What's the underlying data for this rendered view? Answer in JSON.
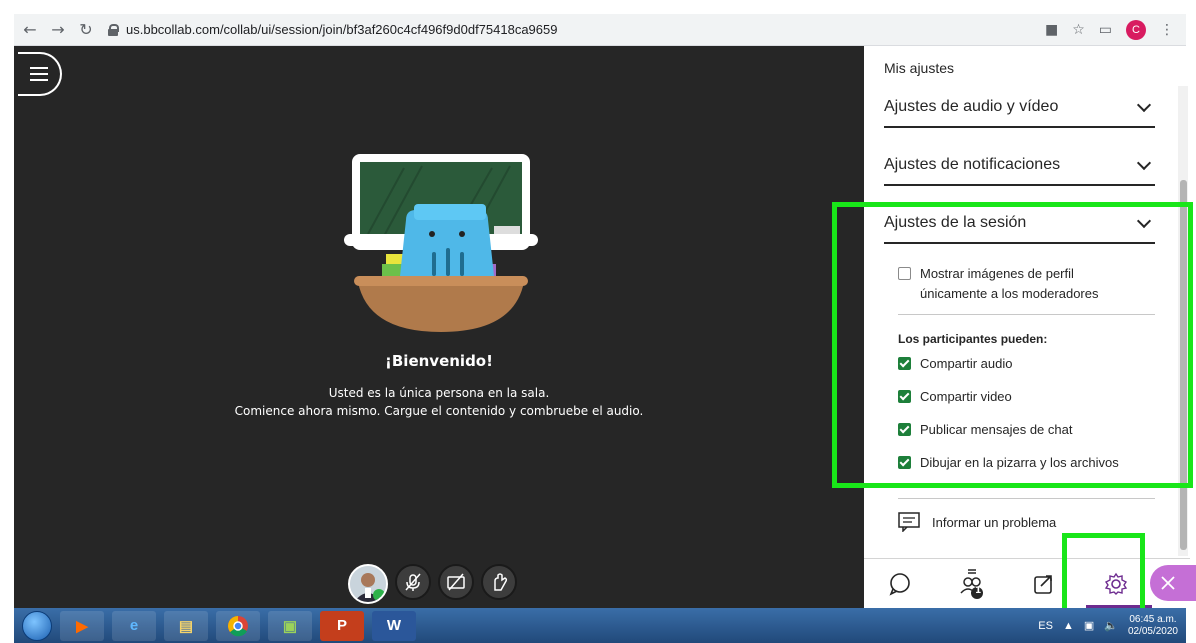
{
  "browser": {
    "url": "us.bbcollab.com/collab/ui/session/join/bf3af260c4cf496f9d0df75418ca9659",
    "profile_initial": "C"
  },
  "stage": {
    "welcome_title": "¡Bienvenido!",
    "welcome_line1": "Usted es la única persona en la sala.",
    "welcome_line2": "Comience ahora mismo. Cargue el contenido y combruebe el audio."
  },
  "panel": {
    "title": "Mis ajustes",
    "sections": [
      {
        "label": "Ajustes de audio y vídeo"
      },
      {
        "label": "Ajustes de notificaciones"
      },
      {
        "label": "Ajustes de la sesión"
      }
    ],
    "profile_option": {
      "label_line1": "Mostrar imágenes de perfil",
      "label_line2": "únicamente a los moderadores",
      "checked": false
    },
    "participants_label": "Los participantes pueden:",
    "participant_options": [
      {
        "label": "Compartir audio",
        "checked": true
      },
      {
        "label": "Compartir video",
        "checked": true
      },
      {
        "label": "Publicar mensajes de chat",
        "checked": true
      },
      {
        "label": "Dibujar en la pizarra y los archivos",
        "checked": true
      }
    ],
    "report_label": "Informar un problema",
    "attendee_count": "1"
  },
  "taskbar": {
    "language": "ES",
    "time": "06:45 a.m.",
    "date": "02/05/2020"
  },
  "colors": {
    "highlight": "#19e619",
    "checkbox_on": "#1d7f3a",
    "active_tab": "#6d2b8f"
  }
}
